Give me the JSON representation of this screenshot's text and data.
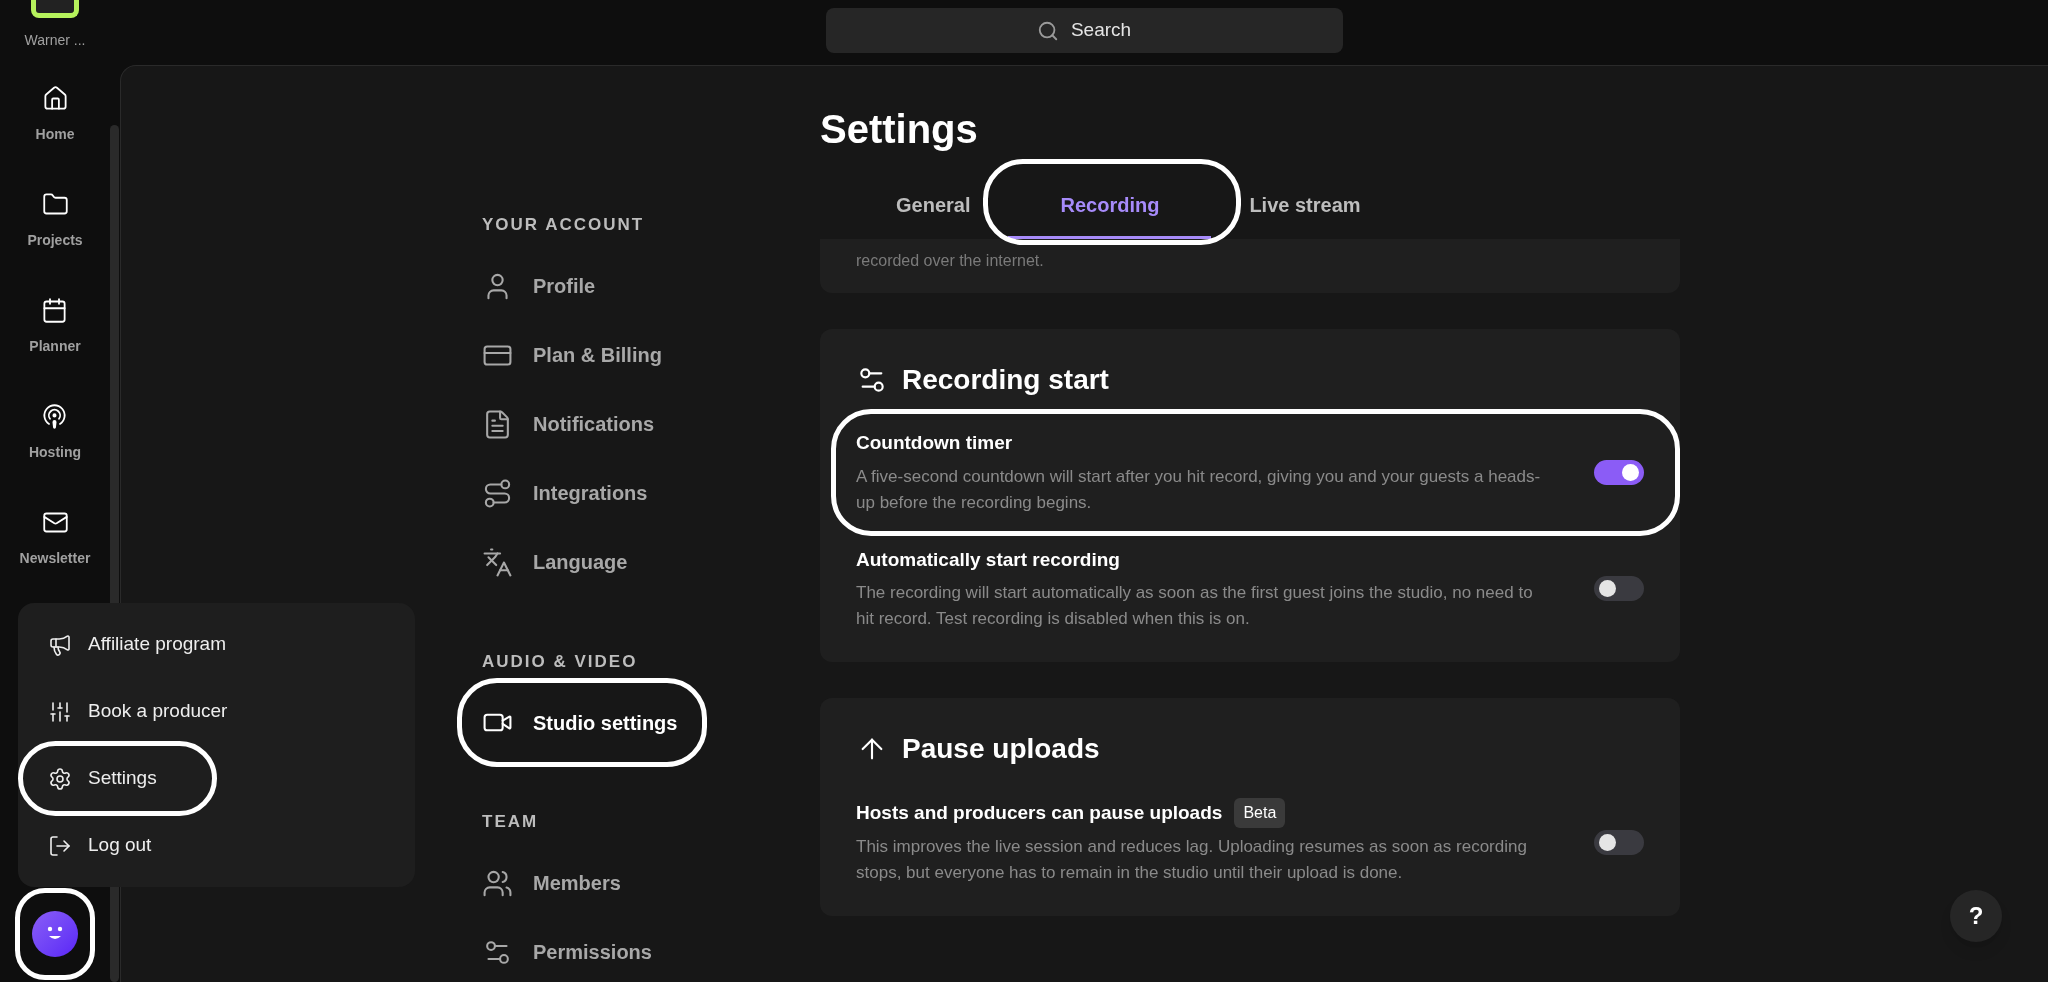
{
  "rail": {
    "workspace": "Warner ...",
    "items": [
      {
        "label": "Home"
      },
      {
        "label": "Projects"
      },
      {
        "label": "Planner"
      },
      {
        "label": "Hosting"
      },
      {
        "label": "Newsletter"
      }
    ],
    "avatar": {
      "highlighted": true
    }
  },
  "search": {
    "placeholder": "Search"
  },
  "menu": {
    "items": [
      {
        "label": "Affiliate program",
        "highlighted": false
      },
      {
        "label": "Book a producer",
        "highlighted": false
      },
      {
        "label": "Settings",
        "highlighted": true
      },
      {
        "label": "Log out",
        "highlighted": false
      }
    ]
  },
  "settings_nav": {
    "sections": [
      {
        "heading": "YOUR ACCOUNT",
        "items": [
          {
            "label": "Profile",
            "selected": false,
            "highlighted": false
          },
          {
            "label": "Plan & Billing",
            "selected": false,
            "highlighted": false
          },
          {
            "label": "Notifications",
            "selected": false,
            "highlighted": false
          },
          {
            "label": "Integrations",
            "selected": false,
            "highlighted": false
          },
          {
            "label": "Language",
            "selected": false,
            "highlighted": false
          }
        ]
      },
      {
        "heading": "AUDIO & VIDEO",
        "items": [
          {
            "label": "Studio settings",
            "selected": true,
            "highlighted": true
          }
        ]
      },
      {
        "heading": "TEAM",
        "items": [
          {
            "label": "Members",
            "selected": false,
            "highlighted": false
          },
          {
            "label": "Permissions",
            "selected": false,
            "highlighted": false
          }
        ]
      }
    ]
  },
  "page": {
    "title": "Settings",
    "tabs": [
      {
        "label": "General",
        "selected": false,
        "highlighted": false
      },
      {
        "label": "Recording",
        "selected": true,
        "highlighted": true
      },
      {
        "label": "Live stream",
        "selected": false,
        "highlighted": false
      }
    ]
  },
  "clipped_card": {
    "text": "recorded over the internet."
  },
  "cards": [
    {
      "title": "Recording start",
      "rows": [
        {
          "title": "Countdown timer",
          "description": "A five-second countdown will start after you hit record, giving you and your guests a heads-up before the recording begins.",
          "on": true,
          "highlighted": true
        },
        {
          "title": "Automatically start recording",
          "description": "The recording will start automatically as soon as the first guest joins the studio, no need to hit record. Test recording is disabled when this is on.",
          "on": false,
          "highlighted": false
        }
      ]
    },
    {
      "title": "Pause uploads",
      "rows": [
        {
          "title": "Hosts and producers can pause uploads",
          "badge": "Beta",
          "description": "This improves the live session and reduces lag. Uploading resumes as soon as recording stops, but everyone has to remain in the studio until their upload is done.",
          "on": false,
          "highlighted": false
        }
      ]
    }
  ],
  "help": {
    "label": "?"
  }
}
